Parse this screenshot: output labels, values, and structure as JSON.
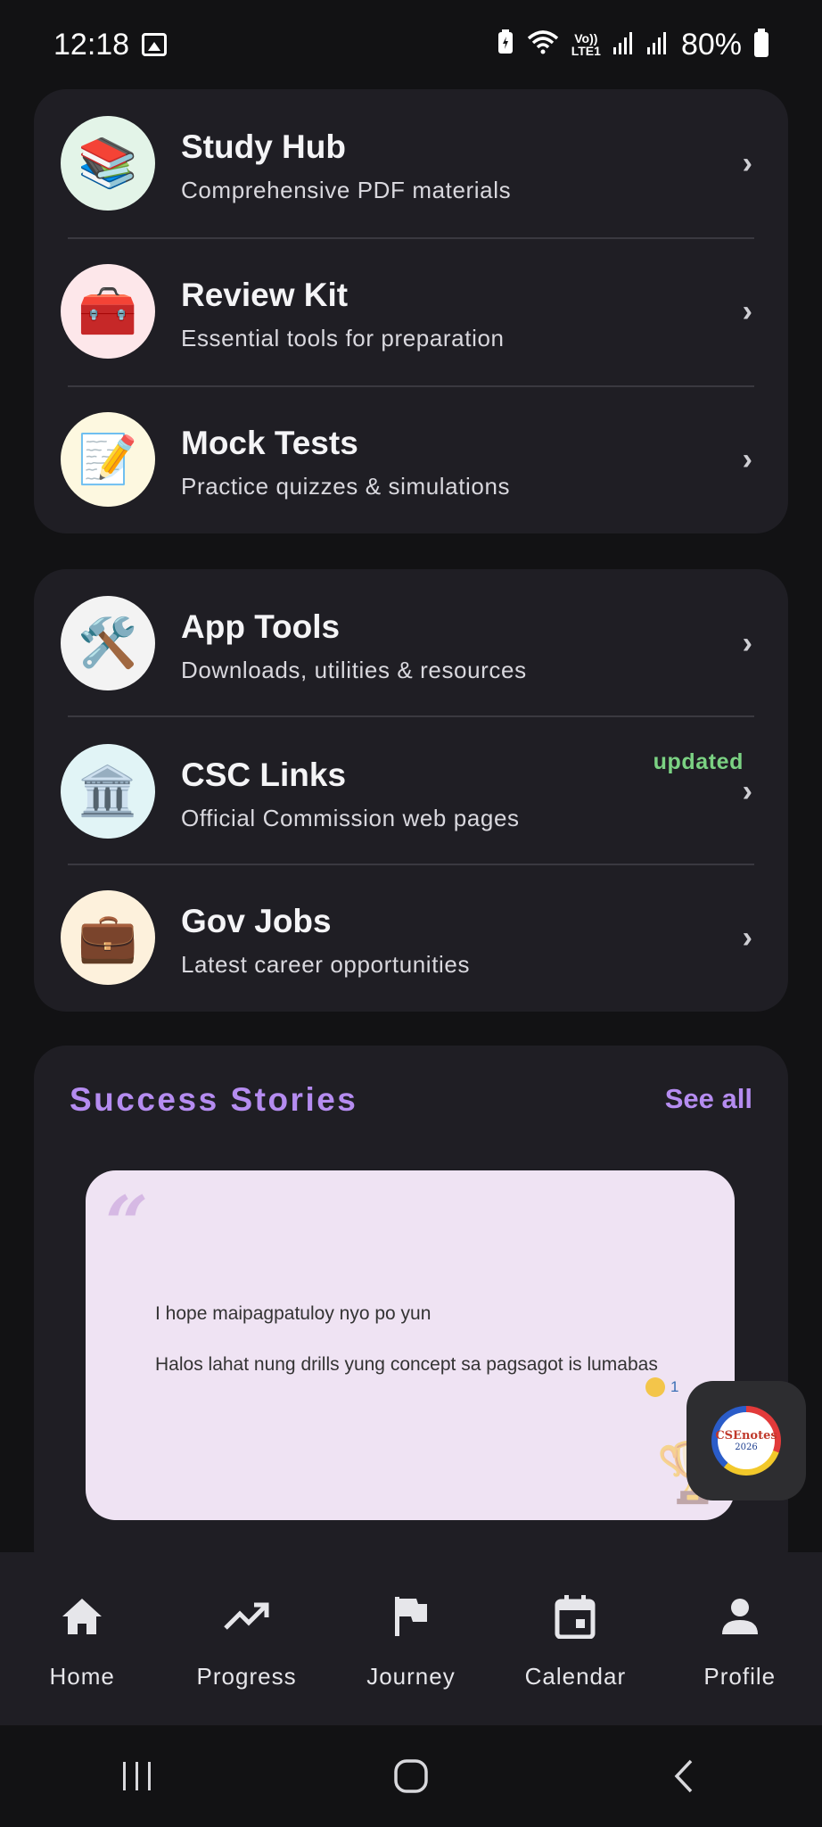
{
  "status_bar": {
    "time": "12:18",
    "network_top": "Vo))",
    "network_bottom": "LTE1",
    "battery": "80%"
  },
  "main_menu": [
    {
      "title": "Study Hub",
      "subtitle": "Comprehensive PDF materials",
      "icon": "📚",
      "icon_bg": "#e3f4e8"
    },
    {
      "title": "Review Kit",
      "subtitle": "Essential tools for preparation",
      "icon": "🧰",
      "icon_bg": "#fde7ea"
    },
    {
      "title": "Mock Tests",
      "subtitle": "Practice quizzes & simulations",
      "icon": "📝",
      "icon_bg": "#fdf8e0"
    }
  ],
  "resources_menu": [
    {
      "title": "App Tools",
      "subtitle": "Downloads, utilities & resources",
      "icon": "🛠️",
      "icon_bg": "#f3f3f3"
    },
    {
      "title": "CSC Links",
      "subtitle": "Official Commission web pages",
      "icon": "🏛️",
      "icon_bg": "#e1f4f6",
      "badge": "updated"
    },
    {
      "title": "Gov Jobs",
      "subtitle": "Latest career opportunities",
      "icon": "💼",
      "icon_bg": "#fdf1dc"
    }
  ],
  "success_stories": {
    "title": "Success Stories",
    "see_all": "See all",
    "quote_line1": "I hope maipagpatuloy nyo po yun",
    "quote_line2": "Halos lahat nung drills yung concept sa pagsagot is lumabas",
    "reaction_count": "1"
  },
  "floating_badge": {
    "title": "CSEnotes",
    "year": "2026"
  },
  "bottom_nav": [
    {
      "label": "Home",
      "icon": "home-icon"
    },
    {
      "label": "Progress",
      "icon": "trending-up-icon"
    },
    {
      "label": "Journey",
      "icon": "flag-icon"
    },
    {
      "label": "Calendar",
      "icon": "calendar-icon"
    },
    {
      "label": "Profile",
      "icon": "person-icon"
    }
  ],
  "colors": {
    "background": "#121214",
    "card": "#1f1e24",
    "accent_purple": "#b58cf0",
    "updated_green": "#7bd283"
  }
}
